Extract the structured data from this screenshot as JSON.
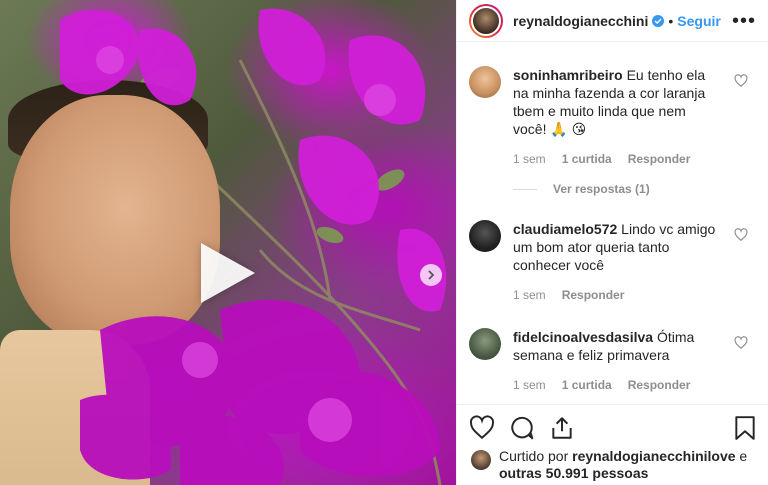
{
  "post": {
    "username": "reynaldogianecchini",
    "dot": "•",
    "follow_label": "Seguir",
    "more_label": "•••"
  },
  "comments": [
    {
      "username": "soninhamribeiro",
      "text": "Eu tenho ela na minha fazenda a cor laranja tbem e muito linda que nem você! 🙏 😘",
      "time": "1 sem",
      "likes": "1 curtida",
      "reply": "Responder",
      "view_replies": "Ver respostas (1)",
      "avatar_color": "#c6905f"
    },
    {
      "username": "claudiamelo572",
      "text": "Lindo vc amigo um bom ator queria tanto conhecer você",
      "time": "1 sem",
      "reply": "Responder",
      "avatar_color": "#2a2a2a"
    },
    {
      "username": "fidelcinoalvesdasilva",
      "text": "Ótima semana e feliz primavera",
      "time": "1 sem",
      "likes": "1 curtida",
      "reply": "Responder",
      "avatar_color": "#4a5a44"
    }
  ],
  "likes_line": {
    "prefix": "Curtido por ",
    "user": "reynaldogianecchinilove",
    "middle": " e",
    "others": "outras 50.991 pessoas"
  },
  "icons": [
    "play-icon",
    "chevron-right-icon",
    "verified-icon",
    "more-icon",
    "heart-icon",
    "comment-icon",
    "share-icon",
    "bookmark-icon"
  ],
  "colors": {
    "link": "#3897f0",
    "muted": "#8e8e8e",
    "text": "#262626",
    "flower": "#c516c8"
  }
}
